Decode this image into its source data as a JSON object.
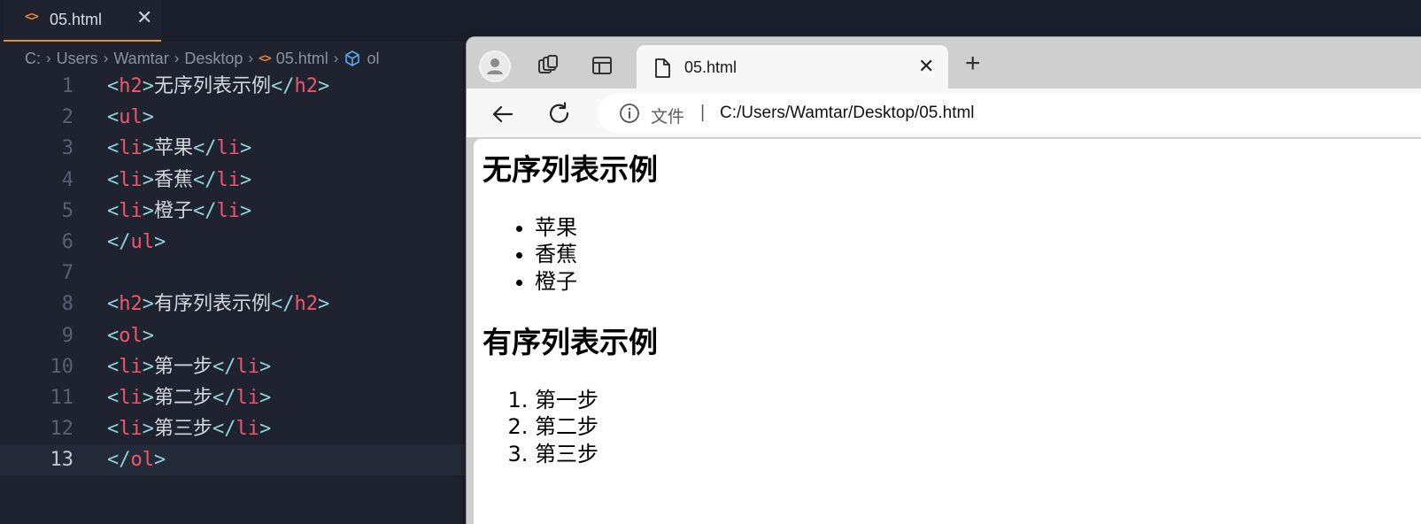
{
  "editor": {
    "tab": {
      "title": "05.html",
      "close_glyph": "✕",
      "icon": "html-code-icon"
    },
    "breadcrumb": {
      "items": [
        "C:",
        "Users",
        "Wamtar",
        "Desktop",
        "05.html",
        "ol"
      ],
      "separator": "›"
    },
    "lines": [
      {
        "n": "1",
        "segs": [
          [
            "punc",
            "<"
          ],
          [
            "tag",
            "h2"
          ],
          [
            "punc",
            ">"
          ],
          [
            "txt",
            "无序列表示例"
          ],
          [
            "punc",
            "</"
          ],
          [
            "tag",
            "h2"
          ],
          [
            "punc",
            ">"
          ]
        ]
      },
      {
        "n": "2",
        "segs": [
          [
            "punc",
            "<"
          ],
          [
            "tag",
            "ul"
          ],
          [
            "punc",
            ">"
          ]
        ]
      },
      {
        "n": "3",
        "segs": [
          [
            "punc",
            "<"
          ],
          [
            "tag",
            "li"
          ],
          [
            "punc",
            ">"
          ],
          [
            "txt",
            "苹果"
          ],
          [
            "punc",
            "</"
          ],
          [
            "tag",
            "li"
          ],
          [
            "punc",
            ">"
          ]
        ]
      },
      {
        "n": "4",
        "segs": [
          [
            "punc",
            "<"
          ],
          [
            "tag",
            "li"
          ],
          [
            "punc",
            ">"
          ],
          [
            "txt",
            "香蕉"
          ],
          [
            "punc",
            "</"
          ],
          [
            "tag",
            "li"
          ],
          [
            "punc",
            ">"
          ]
        ]
      },
      {
        "n": "5",
        "segs": [
          [
            "punc",
            "<"
          ],
          [
            "tag",
            "li"
          ],
          [
            "punc",
            ">"
          ],
          [
            "txt",
            "橙子"
          ],
          [
            "punc",
            "</"
          ],
          [
            "tag",
            "li"
          ],
          [
            "punc",
            ">"
          ]
        ]
      },
      {
        "n": "6",
        "segs": [
          [
            "punc",
            "</"
          ],
          [
            "tag",
            "ul"
          ],
          [
            "punc",
            ">"
          ]
        ]
      },
      {
        "n": "7",
        "segs": []
      },
      {
        "n": "8",
        "segs": [
          [
            "punc",
            "<"
          ],
          [
            "tag",
            "h2"
          ],
          [
            "punc",
            ">"
          ],
          [
            "txt",
            "有序列表示例"
          ],
          [
            "punc",
            "</"
          ],
          [
            "tag",
            "h2"
          ],
          [
            "punc",
            ">"
          ]
        ]
      },
      {
        "n": "9",
        "segs": [
          [
            "punc",
            "<"
          ],
          [
            "tag",
            "ol"
          ],
          [
            "punc",
            ">"
          ]
        ]
      },
      {
        "n": "10",
        "segs": [
          [
            "punc",
            "<"
          ],
          [
            "tag",
            "li"
          ],
          [
            "punc",
            ">"
          ],
          [
            "txt",
            "第一步"
          ],
          [
            "punc",
            "</"
          ],
          [
            "tag",
            "li"
          ],
          [
            "punc",
            ">"
          ]
        ]
      },
      {
        "n": "11",
        "segs": [
          [
            "punc",
            "<"
          ],
          [
            "tag",
            "li"
          ],
          [
            "punc",
            ">"
          ],
          [
            "txt",
            "第二步"
          ],
          [
            "punc",
            "</"
          ],
          [
            "tag",
            "li"
          ],
          [
            "punc",
            ">"
          ]
        ]
      },
      {
        "n": "12",
        "segs": [
          [
            "punc",
            "<"
          ],
          [
            "tag",
            "li"
          ],
          [
            "punc",
            ">"
          ],
          [
            "txt",
            "第三步"
          ],
          [
            "punc",
            "</"
          ],
          [
            "tag",
            "li"
          ],
          [
            "punc",
            ">"
          ]
        ]
      },
      {
        "n": "13",
        "segs": [
          [
            "punc",
            "</"
          ],
          [
            "tag",
            "ol"
          ],
          [
            "punc",
            ">"
          ]
        ]
      }
    ],
    "current_line": "13"
  },
  "browser": {
    "tab": {
      "title": "05.html",
      "close_glyph": "✕",
      "icon": "page-icon"
    },
    "new_tab_glyph": "+",
    "address": {
      "label": "文件",
      "divider": "|",
      "url": "C:/Users/Wamtar/Desktop/05.html"
    },
    "icons": {
      "profile": "profile-avatar-icon",
      "collections": "collections-icon",
      "sidebar": "sidebar-layout-icon",
      "back": "back-arrow-icon",
      "reload": "reload-icon",
      "info": "info-icon"
    }
  },
  "page": {
    "h2_unordered": "无序列表示例",
    "ul_items": [
      "苹果",
      "香蕉",
      "橙子"
    ],
    "h2_ordered": "有序列表示例",
    "ol_items": [
      "第一步",
      "第二步",
      "第三步"
    ]
  },
  "colors": {
    "editor_bg": "#1f2330",
    "tag": "#f0556b",
    "bracket": "#8fd3d8",
    "tab_accent": "#e8902f"
  }
}
